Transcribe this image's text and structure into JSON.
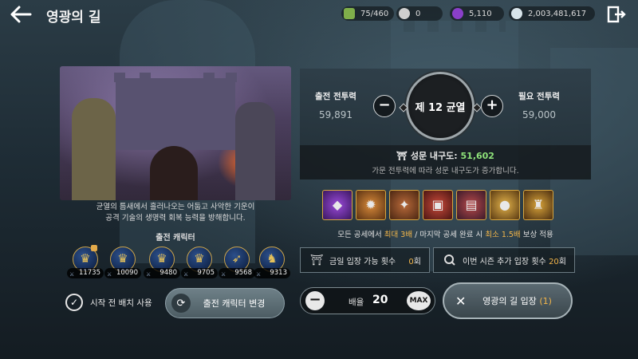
{
  "header": {
    "title": "영광의 길",
    "resources": [
      {
        "name": "stamina",
        "value": "75/460",
        "icon": "stamina-icon",
        "color": "#7fae4a"
      },
      {
        "name": "silver",
        "value": "0",
        "icon": "silver-coin-icon",
        "color": "#cfcfcf"
      },
      {
        "name": "gem",
        "value": "5,110",
        "icon": "purple-gem-icon",
        "color": "#8a3fc9"
      },
      {
        "name": "gold",
        "value": "2,003,481,617",
        "icon": "coin-icon",
        "color": "#d8e4ea"
      }
    ]
  },
  "left": {
    "description_line1": "균열의 틈새에서 흘러나오는 어둡고 사악한 기운이",
    "description_line2": "공격 기술의 생명력 회복 능력을 방해합니다.",
    "characters_title": "출전 캐릭터",
    "characters": [
      {
        "power": "11735",
        "locked": true
      },
      {
        "power": "10090"
      },
      {
        "power": "9480"
      },
      {
        "power": "9705"
      },
      {
        "power": "9568"
      },
      {
        "power": "9313"
      }
    ],
    "pre_deploy_label": "시작 전 배치 사용",
    "change_button_label": "출전 캐릭터 변경"
  },
  "right": {
    "deploy_power_label": "출전 전투력",
    "deploy_power_value": "59,891",
    "required_power_label": "필요 전투력",
    "required_power_value": "59,000",
    "rift_label": "제 12 균열",
    "durability_label": "성문 내구도:",
    "durability_value": "51,602",
    "durability_note": "가문 전투력에 따라 성문 내구도가 증가합니다.",
    "reward_note_prefix": "모든 공세에서 ",
    "reward_note_max": "최대 3배",
    "reward_note_mid": " / 마지막 공세 완료 시 ",
    "reward_note_min": "최소 1.5배",
    "reward_note_suffix": " 보상 적용",
    "daily_entry_label": "금일 입장 가능 횟수",
    "daily_entry_count": "0",
    "daily_entry_unit": "회",
    "season_entry_label": "이번 시즌 추가 입장 횟수",
    "season_entry_count": "20",
    "season_entry_unit": "회",
    "multiplier_label": "배율",
    "multiplier_value": "20",
    "max_label": "MAX",
    "enter_label": "영광의 길 입장",
    "enter_count": "(1)"
  }
}
